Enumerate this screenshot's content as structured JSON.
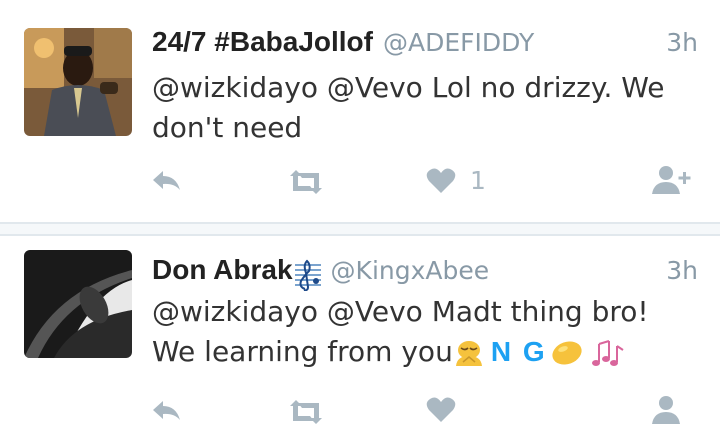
{
  "tweets": [
    {
      "name": "24/7 #BabaJollof",
      "handle": "@ADEFIDDY",
      "time": "3h",
      "text": "@wizkidayo @Vevo Lol no drizzy. We don't need",
      "actions": {
        "reply_icon": "reply-icon",
        "retweet_icon": "retweet-icon",
        "like_icon": "heart-icon",
        "like_count": "1",
        "follow_icon": "follow-user-icon"
      }
    },
    {
      "name": "Don Abrak",
      "name_emoji": "musical-score-icon",
      "handle": "@KingxAbee",
      "time": "3h",
      "text_line1": "@wizkidayo @Vevo Madt thing bro!",
      "text_line2": "We learning from you",
      "text_ng": "N G",
      "emojis": [
        "person-bowing-icon",
        "lemon-icon",
        "musical-notes-icon"
      ]
    }
  ],
  "colors": {
    "meta": "#8899a6",
    "icon": "#aab8c2",
    "divider": "#e1e8ed",
    "accent": "#1da1f2",
    "text": "#333333"
  }
}
